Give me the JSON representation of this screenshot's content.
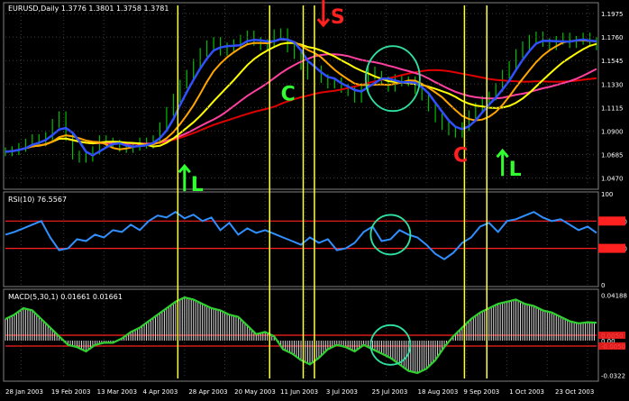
{
  "chart_data": {
    "type": "line",
    "main": {
      "header": "EURUSD,Daily  1.3776 1.3801 1.3758 1.3781",
      "yticks": [
        1.1975,
        1.176,
        1.1545,
        1.133,
        1.1115,
        1.09,
        1.0685,
        1.047
      ],
      "ylim": [
        1.04,
        1.205
      ],
      "series": [
        {
          "name": "",
          "color": "#00c000",
          "role": "price",
          "x": [
            0,
            3,
            6,
            9,
            12,
            15,
            18,
            21,
            24,
            27,
            30,
            33,
            36,
            39,
            42,
            45,
            48,
            51,
            54,
            57,
            60,
            63,
            66,
            69,
            72,
            75,
            78,
            81,
            84,
            87,
            90,
            93,
            96,
            99,
            102,
            105,
            108,
            111,
            114,
            117,
            120,
            123,
            126,
            129,
            132,
            135,
            138,
            141,
            144,
            147,
            150,
            153,
            156,
            159,
            162,
            165,
            168,
            171,
            174,
            177,
            180,
            183,
            186,
            189,
            192,
            195,
            198,
            201,
            204,
            207,
            210,
            213,
            216,
            219,
            222,
            225,
            228,
            231,
            234,
            237,
            240,
            243,
            246,
            249,
            252,
            255,
            258,
            261,
            264
          ],
          "values": [
            1.071,
            1.072,
            1.075,
            1.079,
            1.083,
            1.08,
            1.085,
            1.097,
            1.104,
            1.085,
            1.068,
            1.065,
            1.066,
            1.072,
            1.082,
            1.08,
            1.078,
            1.075,
            1.074,
            1.076,
            1.08,
            1.078,
            1.082,
            1.094,
            1.108,
            1.12,
            1.133,
            1.142,
            1.152,
            1.162,
            1.169,
            1.172,
            1.163,
            1.167,
            1.17,
            1.174,
            1.178,
            1.172,
            1.168,
            1.17,
            1.179,
            1.18,
            1.166,
            1.16,
            1.15,
            1.141,
            1.146,
            1.138,
            1.133,
            1.135,
            1.129,
            1.126,
            1.12,
            1.13,
            1.145,
            1.141,
            1.136,
            1.13,
            1.138,
            1.135,
            1.136,
            1.128,
            1.122,
            1.112,
            1.102,
            1.095,
            1.09,
            1.088,
            1.094,
            1.105,
            1.112,
            1.118,
            1.122,
            1.13,
            1.142,
            1.15,
            1.161,
            1.168,
            1.174,
            1.177,
            1.171,
            1.168,
            1.173,
            1.176,
            1.17,
            1.173,
            1.176,
            1.172,
            1.168
          ]
        },
        {
          "name": "",
          "color": "#3050ff",
          "role": "fast-ma",
          "smooth": 3
        },
        {
          "name": "",
          "color": "#ffa500",
          "role": "ma",
          "smooth": 7
        },
        {
          "name": "",
          "color": "#ffff00",
          "role": "ma",
          "smooth": 13
        },
        {
          "name": "",
          "color": "#ff40a0",
          "role": "ma",
          "smooth": 22
        },
        {
          "name": "",
          "color": "#e00000",
          "role": "ma",
          "smooth": 40
        }
      ]
    },
    "rsi": {
      "header": "RSI(10) 76.5567",
      "yticks_left": [
        "100",
        "70.0000",
        "40.0000",
        "0"
      ],
      "levels": [
        70,
        40
      ],
      "ylim": [
        0,
        100
      ],
      "color": "#3090ff",
      "x": [
        0,
        4,
        8,
        12,
        16,
        20,
        24,
        28,
        32,
        36,
        40,
        44,
        48,
        52,
        56,
        60,
        64,
        68,
        72,
        76,
        80,
        84,
        88,
        92,
        96,
        100,
        104,
        108,
        112,
        116,
        120,
        124,
        128,
        132,
        136,
        140,
        144,
        148,
        152,
        156,
        160,
        164,
        168,
        172,
        176,
        180,
        184,
        188,
        192,
        196,
        200,
        204,
        208,
        212,
        216,
        220,
        224,
        228,
        232,
        236,
        240,
        244,
        248,
        252,
        256,
        260,
        264
      ],
      "values": [
        55,
        58,
        62,
        66,
        70,
        52,
        38,
        40,
        50,
        48,
        55,
        52,
        60,
        58,
        66,
        60,
        70,
        76,
        74,
        80,
        73,
        77,
        70,
        74,
        60,
        68,
        55,
        62,
        57,
        60,
        56,
        52,
        48,
        44,
        52,
        46,
        50,
        38,
        40,
        46,
        58,
        64,
        48,
        50,
        60,
        55,
        52,
        44,
        34,
        28,
        35,
        46,
        52,
        64,
        68,
        58,
        70,
        72,
        76,
        80,
        74,
        70,
        72,
        66,
        60,
        64,
        57
      ]
    },
    "macd": {
      "header": "MACD(5,30,1) 0.01661 0.01661",
      "yticks_left": [
        "0.04188",
        "0.0050",
        "0.00",
        "-0.0050",
        "-0.0322"
      ],
      "levels": [
        0.005,
        -0.005
      ],
      "ylim": [
        -0.035,
        0.045
      ],
      "color": "#30d030",
      "x": [
        0,
        4,
        8,
        12,
        16,
        20,
        24,
        28,
        32,
        36,
        40,
        44,
        48,
        52,
        56,
        60,
        64,
        68,
        72,
        76,
        80,
        84,
        88,
        92,
        96,
        100,
        104,
        108,
        112,
        116,
        120,
        124,
        128,
        132,
        136,
        140,
        144,
        148,
        152,
        156,
        160,
        164,
        168,
        172,
        176,
        180,
        184,
        188,
        192,
        196,
        200,
        204,
        208,
        212,
        216,
        220,
        224,
        228,
        232,
        236,
        240,
        244,
        248,
        252,
        256,
        260,
        264
      ],
      "values": [
        0.02,
        0.024,
        0.03,
        0.028,
        0.02,
        0.012,
        0.004,
        -0.004,
        -0.006,
        -0.01,
        -0.004,
        -0.002,
        -0.002,
        0.002,
        0.008,
        0.012,
        0.018,
        0.024,
        0.03,
        0.036,
        0.04,
        0.038,
        0.034,
        0.03,
        0.028,
        0.024,
        0.022,
        0.014,
        0.006,
        0.008,
        0.004,
        -0.008,
        -0.012,
        -0.018,
        -0.022,
        -0.016,
        -0.008,
        -0.004,
        -0.006,
        -0.01,
        -0.004,
        -0.008,
        -0.012,
        -0.016,
        -0.022,
        -0.028,
        -0.03,
        -0.026,
        -0.018,
        -0.006,
        0.004,
        0.012,
        0.02,
        0.026,
        0.03,
        0.034,
        0.036,
        0.038,
        0.034,
        0.032,
        0.028,
        0.026,
        0.022,
        0.018,
        0.016,
        0.017,
        0.0166
      ]
    },
    "x_range": [
      0,
      264
    ],
    "x_tick_positions": [
      7,
      26,
      44,
      62,
      80,
      98,
      116,
      134,
      152,
      170,
      188,
      206,
      224,
      242,
      260
    ],
    "x_ticks": [
      "28 Jan 2003",
      "19 Feb 2003",
      "13 Mar 2003",
      "4 Apr 2003",
      "28 Apr 2003",
      "20 May 2003",
      "11 Jun 2003",
      "3 Jul 2003",
      "25 Jul 2003",
      "18 Aug 2003",
      "9 Sep 2003",
      "1 Oct 2003",
      "23 Oct 2003"
    ],
    "x_tick_index": [
      0,
      7,
      14,
      26,
      35,
      44,
      53,
      62,
      72,
      84,
      94,
      106,
      118
    ],
    "vertical_lines_x": [
      77,
      118,
      133,
      138,
      205,
      215
    ],
    "annotations": [
      {
        "text": "L",
        "color": "#30ff30",
        "x": 80,
        "panel": "main",
        "y": 1.058,
        "arrow": "up"
      },
      {
        "text": "C",
        "color": "#30ff30",
        "x": 123,
        "panel": "main",
        "y": 1.118
      },
      {
        "text": "S",
        "color": "#ff2020",
        "x": 142,
        "panel": "main",
        "y": 1.195,
        "arrow": "down"
      },
      {
        "text": "C",
        "color": "#ff2020",
        "x": 200,
        "panel": "main",
        "y": 1.062
      },
      {
        "text": "L",
        "color": "#30ff30",
        "x": 222,
        "panel": "main",
        "y": 1.072,
        "arrow": "up"
      }
    ],
    "circles": [
      {
        "panel": "main",
        "x": 173,
        "y": 1.138,
        "color": "#30e0a0"
      },
      {
        "panel": "rsi",
        "x": 172,
        "y": 55,
        "color": "#30e0a0"
      },
      {
        "panel": "macd",
        "x": 172,
        "y": -0.004,
        "color": "#30e0a0"
      }
    ]
  }
}
